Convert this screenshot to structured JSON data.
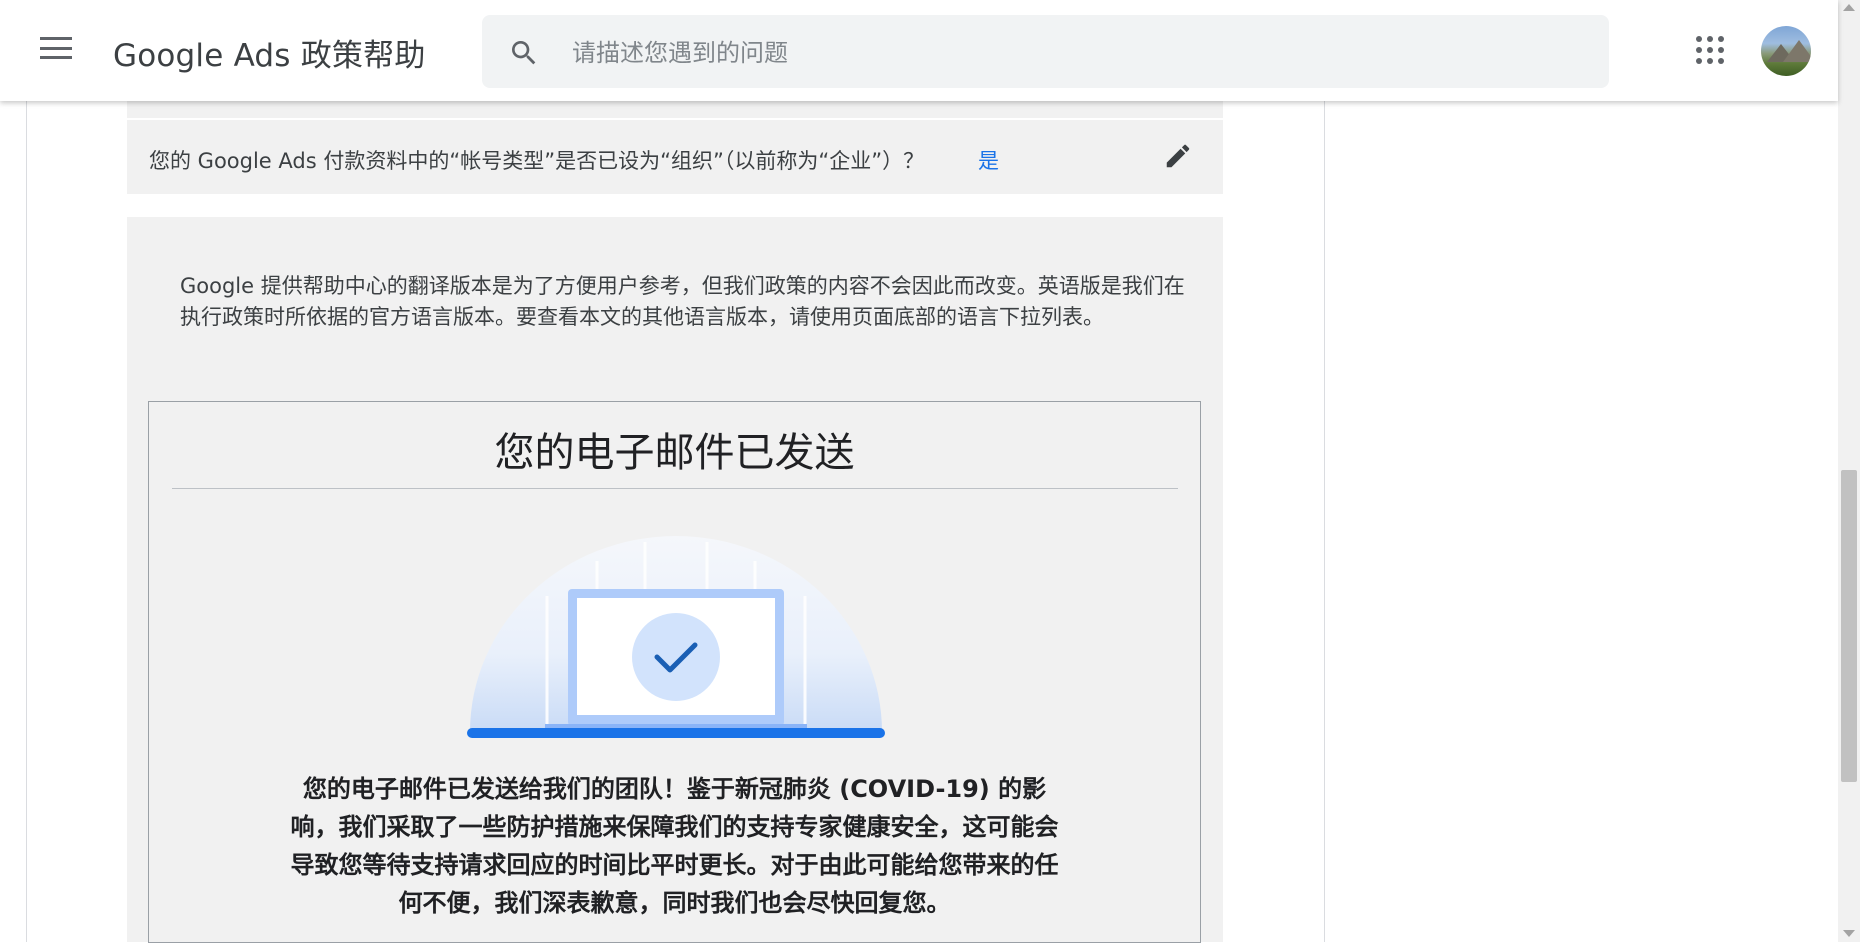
{
  "header": {
    "app_title": "Google Ads 政策帮助",
    "search_placeholder": "请描述您遇到的问题"
  },
  "question": {
    "text": "您的 Google Ads 付款资料中的“帐号类型”是否已设为“组织”（以前称为“企业”）？",
    "answer": "是"
  },
  "notice": {
    "text": "Google 提供帮助中心的翻译版本是为了方便用户参考，但我们政策的内容不会因此而改变。英语版是我们在执行政策时所依据的官方语言版本。要查看本文的其他语言版本，请使用页面底部的语言下拉列表。"
  },
  "email_card": {
    "title": "您的电子邮件已发送",
    "message": "您的电子邮件已发送给我们的团队！鉴于新冠肺炎 (COVID-19) 的影响，我们采取了一些防护措施来保障我们的支持专家健康安全，这可能会导致您等待支持请求回应的时间比平时更长。对于由此可能给您带来的任何不便，我们深表歉意，同时我们也会尽快回复您。"
  },
  "icons": {
    "menu": "menu-icon",
    "search": "search-icon",
    "apps": "apps-grid-icon",
    "edit": "pencil-icon",
    "check": "checkmark-icon"
  },
  "colors": {
    "accent": "#1a73e8",
    "panel_bg": "#f1f1f1",
    "search_bg": "#f1f3f4"
  }
}
